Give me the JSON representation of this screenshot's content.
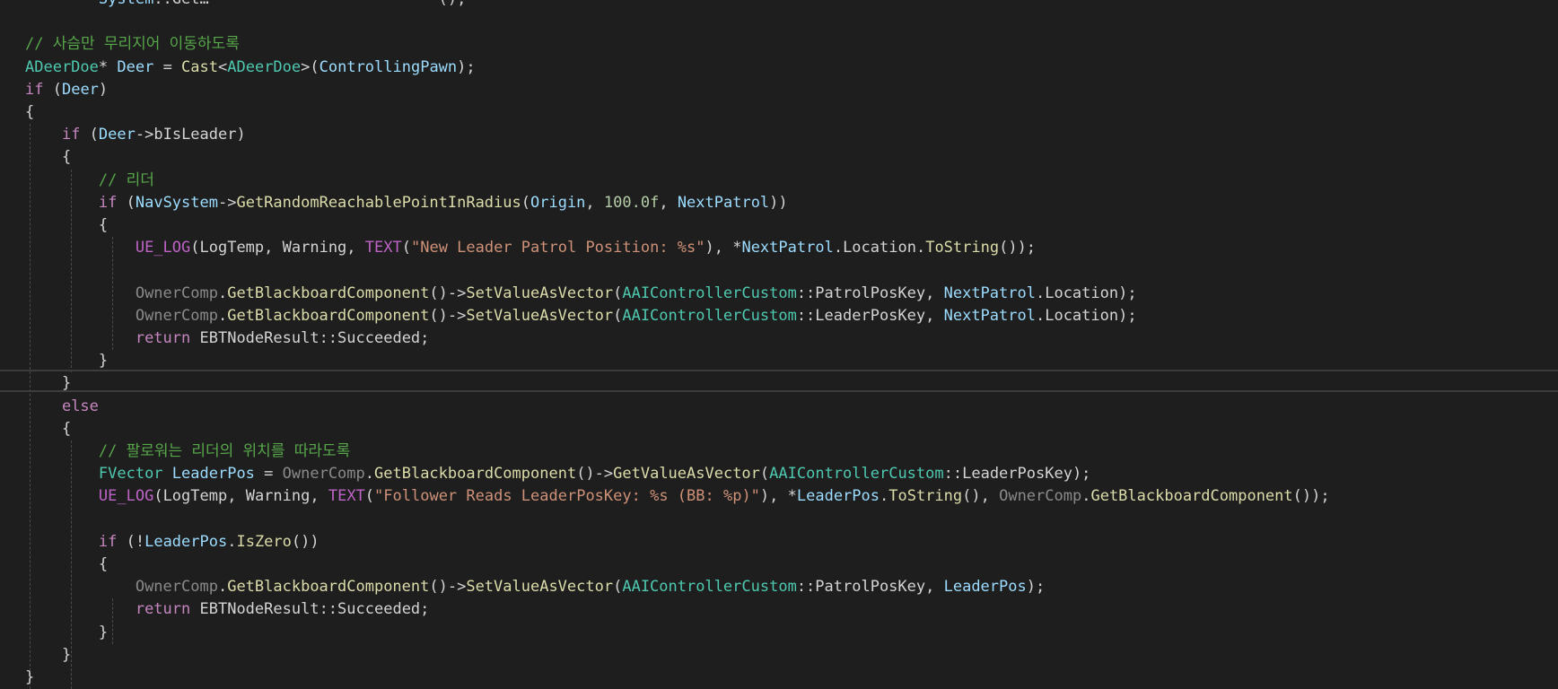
{
  "editor": {
    "colors": {
      "background": "#1e1e1e",
      "keyword": "#c586c0",
      "type": "#4ec9b0",
      "function": "#dcdcaa",
      "variable": "#9cdcfe",
      "string": "#ce9178",
      "number": "#b5cea8",
      "comment": "#57a64a"
    },
    "lines": [
      {
        "tokens": [
          {
            "t": "        ",
            "c": "pu"
          },
          {
            "t": "System",
            "c": "va"
          },
          {
            "t": "::Get",
            "c": "pu"
          },
          {
            "t": "…",
            "c": "pu"
          },
          {
            "t": "                         ()",
            "c": "pu"
          },
          {
            "t": ";",
            "c": "pu"
          }
        ]
      },
      {
        "tokens": []
      },
      {
        "tokens": [
          {
            "t": "// 사슴만 무리지어 이동하도록",
            "c": "cm"
          }
        ]
      },
      {
        "tokens": [
          {
            "t": "ADeerDoe",
            "c": "ty"
          },
          {
            "t": "* ",
            "c": "pu"
          },
          {
            "t": "Deer",
            "c": "va"
          },
          {
            "t": " = ",
            "c": "pu"
          },
          {
            "t": "Cast",
            "c": "fn"
          },
          {
            "t": "<",
            "c": "pu"
          },
          {
            "t": "ADeerDoe",
            "c": "ty"
          },
          {
            "t": ">(",
            "c": "pu"
          },
          {
            "t": "ControllingPawn",
            "c": "va"
          },
          {
            "t": ");",
            "c": "pu"
          }
        ]
      },
      {
        "tokens": [
          {
            "t": "if",
            "c": "kw"
          },
          {
            "t": " (",
            "c": "pu"
          },
          {
            "t": "Deer",
            "c": "va"
          },
          {
            "t": ")",
            "c": "pu"
          }
        ]
      },
      {
        "tokens": [
          {
            "t": "{",
            "c": "pu"
          }
        ]
      },
      {
        "tokens": [
          {
            "t": "    ",
            "c": "pu"
          },
          {
            "t": "if",
            "c": "kw"
          },
          {
            "t": " (",
            "c": "pu"
          },
          {
            "t": "Deer",
            "c": "va"
          },
          {
            "t": "->",
            "c": "pu"
          },
          {
            "t": "bIsLeader",
            "c": "lv"
          },
          {
            "t": ")",
            "c": "pu"
          }
        ]
      },
      {
        "tokens": [
          {
            "t": "    {",
            "c": "pu"
          }
        ]
      },
      {
        "tokens": [
          {
            "t": "        ",
            "c": "pu"
          },
          {
            "t": "// 리더",
            "c": "cm"
          }
        ]
      },
      {
        "tokens": [
          {
            "t": "        ",
            "c": "pu"
          },
          {
            "t": "if",
            "c": "kw"
          },
          {
            "t": " (",
            "c": "pu"
          },
          {
            "t": "NavSystem",
            "c": "va"
          },
          {
            "t": "->",
            "c": "pu"
          },
          {
            "t": "GetRandomReachablePointInRadius",
            "c": "fn"
          },
          {
            "t": "(",
            "c": "pu"
          },
          {
            "t": "Origin",
            "c": "va"
          },
          {
            "t": ", ",
            "c": "pu"
          },
          {
            "t": "100.0f",
            "c": "nu"
          },
          {
            "t": ", ",
            "c": "pu"
          },
          {
            "t": "NextPatrol",
            "c": "va"
          },
          {
            "t": "))",
            "c": "pu"
          }
        ]
      },
      {
        "tokens": [
          {
            "t": "        {",
            "c": "pu"
          }
        ]
      },
      {
        "tokens": [
          {
            "t": "            ",
            "c": "pu"
          },
          {
            "t": "UE_LOG",
            "c": "mc"
          },
          {
            "t": "(",
            "c": "pu"
          },
          {
            "t": "LogTemp",
            "c": "lv"
          },
          {
            "t": ", ",
            "c": "pu"
          },
          {
            "t": "Warning",
            "c": "lv"
          },
          {
            "t": ", ",
            "c": "pu"
          },
          {
            "t": "TEXT",
            "c": "mc"
          },
          {
            "t": "(",
            "c": "pu"
          },
          {
            "t": "\"New Leader Patrol Position: %s\"",
            "c": "st"
          },
          {
            "t": "), *",
            "c": "pu"
          },
          {
            "t": "NextPatrol",
            "c": "va"
          },
          {
            "t": ".",
            "c": "pu"
          },
          {
            "t": "Location",
            "c": "lv"
          },
          {
            "t": ".",
            "c": "pu"
          },
          {
            "t": "ToString",
            "c": "fn"
          },
          {
            "t": "());",
            "c": "pu"
          }
        ]
      },
      {
        "tokens": []
      },
      {
        "tokens": [
          {
            "t": "            ",
            "c": "pu"
          },
          {
            "t": "OwnerComp",
            "c": "dim"
          },
          {
            "t": ".",
            "c": "pu"
          },
          {
            "t": "GetBlackboardComponent",
            "c": "fn"
          },
          {
            "t": "()->",
            "c": "pu"
          },
          {
            "t": "SetValueAsVector",
            "c": "fn"
          },
          {
            "t": "(",
            "c": "pu"
          },
          {
            "t": "AAIControllerCustom",
            "c": "ty"
          },
          {
            "t": "::",
            "c": "pu"
          },
          {
            "t": "PatrolPosKey",
            "c": "lv"
          },
          {
            "t": ", ",
            "c": "pu"
          },
          {
            "t": "NextPatrol",
            "c": "va"
          },
          {
            "t": ".",
            "c": "pu"
          },
          {
            "t": "Location",
            "c": "lv"
          },
          {
            "t": ");",
            "c": "pu"
          }
        ]
      },
      {
        "tokens": [
          {
            "t": "            ",
            "c": "pu"
          },
          {
            "t": "OwnerComp",
            "c": "dim"
          },
          {
            "t": ".",
            "c": "pu"
          },
          {
            "t": "GetBlackboardComponent",
            "c": "fn"
          },
          {
            "t": "()->",
            "c": "pu"
          },
          {
            "t": "SetValueAsVector",
            "c": "fn"
          },
          {
            "t": "(",
            "c": "pu"
          },
          {
            "t": "AAIControllerCustom",
            "c": "ty"
          },
          {
            "t": "::",
            "c": "pu"
          },
          {
            "t": "LeaderPosKey",
            "c": "lv"
          },
          {
            "t": ", ",
            "c": "pu"
          },
          {
            "t": "NextPatrol",
            "c": "va"
          },
          {
            "t": ".",
            "c": "pu"
          },
          {
            "t": "Location",
            "c": "lv"
          },
          {
            "t": ");",
            "c": "pu"
          }
        ]
      },
      {
        "tokens": [
          {
            "t": "            ",
            "c": "pu"
          },
          {
            "t": "return",
            "c": "kw"
          },
          {
            "t": " ",
            "c": "pu"
          },
          {
            "t": "EBTNodeResult",
            "c": "lv"
          },
          {
            "t": "::",
            "c": "pu"
          },
          {
            "t": "Succeeded",
            "c": "lv"
          },
          {
            "t": ";",
            "c": "pu"
          }
        ]
      },
      {
        "tokens": [
          {
            "t": "        }",
            "c": "pu"
          }
        ]
      },
      {
        "tokens": [
          {
            "t": "    }",
            "c": "pu"
          }
        ]
      },
      {
        "tokens": [
          {
            "t": "    ",
            "c": "pu"
          },
          {
            "t": "else",
            "c": "kw"
          }
        ]
      },
      {
        "tokens": [
          {
            "t": "    {",
            "c": "pu"
          }
        ]
      },
      {
        "tokens": [
          {
            "t": "        ",
            "c": "pu"
          },
          {
            "t": "// 팔로워는 리더의 위치를 따라도록",
            "c": "cm"
          }
        ]
      },
      {
        "tokens": [
          {
            "t": "        ",
            "c": "pu"
          },
          {
            "t": "FVector",
            "c": "ty"
          },
          {
            "t": " ",
            "c": "pu"
          },
          {
            "t": "LeaderPos",
            "c": "va"
          },
          {
            "t": " = ",
            "c": "pu"
          },
          {
            "t": "OwnerComp",
            "c": "dim"
          },
          {
            "t": ".",
            "c": "pu"
          },
          {
            "t": "GetBlackboardComponent",
            "c": "fn"
          },
          {
            "t": "()->",
            "c": "pu"
          },
          {
            "t": "GetValueAsVector",
            "c": "fn"
          },
          {
            "t": "(",
            "c": "pu"
          },
          {
            "t": "AAIControllerCustom",
            "c": "ty"
          },
          {
            "t": "::",
            "c": "pu"
          },
          {
            "t": "LeaderPosKey",
            "c": "lv"
          },
          {
            "t": ");",
            "c": "pu"
          }
        ]
      },
      {
        "tokens": [
          {
            "t": "        ",
            "c": "pu"
          },
          {
            "t": "UE_LOG",
            "c": "mc"
          },
          {
            "t": "(",
            "c": "pu"
          },
          {
            "t": "LogTemp",
            "c": "lv"
          },
          {
            "t": ", ",
            "c": "pu"
          },
          {
            "t": "Warning",
            "c": "lv"
          },
          {
            "t": ", ",
            "c": "pu"
          },
          {
            "t": "TEXT",
            "c": "mc"
          },
          {
            "t": "(",
            "c": "pu"
          },
          {
            "t": "\"Follower Reads LeaderPosKey: %s (BB: %p)\"",
            "c": "st"
          },
          {
            "t": "), *",
            "c": "pu"
          },
          {
            "t": "LeaderPos",
            "c": "va"
          },
          {
            "t": ".",
            "c": "pu"
          },
          {
            "t": "ToString",
            "c": "fn"
          },
          {
            "t": "(), ",
            "c": "pu"
          },
          {
            "t": "OwnerComp",
            "c": "dim"
          },
          {
            "t": ".",
            "c": "pu"
          },
          {
            "t": "GetBlackboardComponent",
            "c": "fn"
          },
          {
            "t": "());",
            "c": "pu"
          }
        ]
      },
      {
        "tokens": []
      },
      {
        "tokens": [
          {
            "t": "        ",
            "c": "pu"
          },
          {
            "t": "if",
            "c": "kw"
          },
          {
            "t": " (!",
            "c": "pu"
          },
          {
            "t": "LeaderPos",
            "c": "va"
          },
          {
            "t": ".",
            "c": "pu"
          },
          {
            "t": "IsZero",
            "c": "fn"
          },
          {
            "t": "())",
            "c": "pu"
          }
        ]
      },
      {
        "tokens": [
          {
            "t": "        {",
            "c": "pu"
          }
        ]
      },
      {
        "tokens": [
          {
            "t": "            ",
            "c": "pu"
          },
          {
            "t": "OwnerComp",
            "c": "dim"
          },
          {
            "t": ".",
            "c": "pu"
          },
          {
            "t": "GetBlackboardComponent",
            "c": "fn"
          },
          {
            "t": "()->",
            "c": "pu"
          },
          {
            "t": "SetValueAsVector",
            "c": "fn"
          },
          {
            "t": "(",
            "c": "pu"
          },
          {
            "t": "AAIControllerCustom",
            "c": "ty"
          },
          {
            "t": "::",
            "c": "pu"
          },
          {
            "t": "PatrolPosKey",
            "c": "lv"
          },
          {
            "t": ", ",
            "c": "pu"
          },
          {
            "t": "LeaderPos",
            "c": "va"
          },
          {
            "t": ");",
            "c": "pu"
          }
        ]
      },
      {
        "tokens": [
          {
            "t": "            ",
            "c": "pu"
          },
          {
            "t": "return",
            "c": "kw"
          },
          {
            "t": " ",
            "c": "pu"
          },
          {
            "t": "EBTNodeResult",
            "c": "lv"
          },
          {
            "t": "::",
            "c": "pu"
          },
          {
            "t": "Succeeded",
            "c": "lv"
          },
          {
            "t": ";",
            "c": "pu"
          }
        ]
      },
      {
        "tokens": [
          {
            "t": "        }",
            "c": "pu"
          }
        ]
      },
      {
        "tokens": [
          {
            "t": "    }",
            "c": "pu"
          }
        ]
      },
      {
        "tokens": [
          {
            "t": "}",
            "c": "pu"
          }
        ]
      }
    ]
  }
}
